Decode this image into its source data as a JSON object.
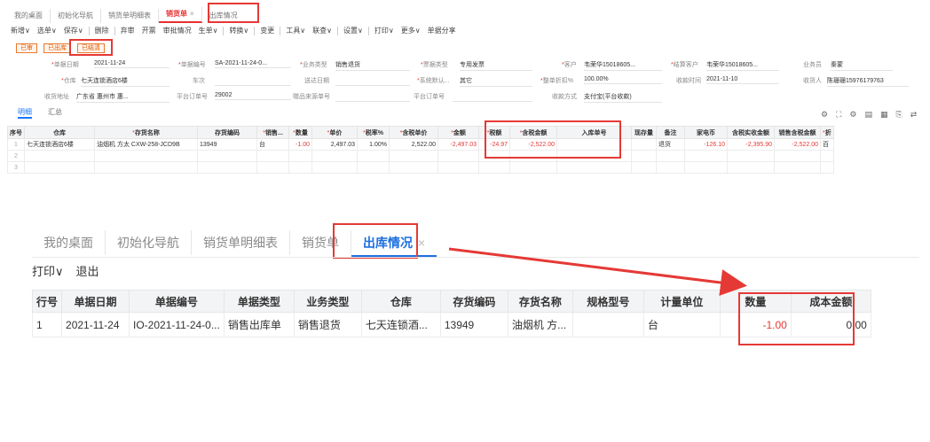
{
  "small_tabs": [
    {
      "label": "我的桌面"
    },
    {
      "label": "初始化导航"
    },
    {
      "label": "销货单明细表"
    },
    {
      "label": "销货单",
      "close": "×"
    },
    {
      "label": "出库情况"
    }
  ],
  "small_toolbar": [
    {
      "label": "新增∨"
    },
    {
      "label": "选单∨"
    },
    {
      "label": "保存∨"
    },
    {
      "label": "删除"
    },
    {
      "label": "弃审"
    },
    {
      "label": "开票"
    },
    {
      "label": "审批情况"
    },
    {
      "label": "生单∨"
    },
    {
      "label": "转换∨"
    },
    {
      "label": "变更"
    },
    {
      "label": "工具∨"
    },
    {
      "label": "联查∨"
    },
    {
      "label": "设置∨"
    },
    {
      "label": "打印∨"
    },
    {
      "label": "更多∨"
    },
    {
      "label": "单据分享"
    }
  ],
  "status_badges": [
    "已审",
    "已出库",
    "已结清"
  ],
  "form": {
    "doc_date_label": "单据日期",
    "doc_date": "2021-11-24",
    "doc_no_label": "单据编号",
    "doc_no": "SA-2021-11-24-0...",
    "biz_type_label": "业务类型",
    "biz_type": "销售退货",
    "invoice_type_label": "票据类型",
    "invoice_type": "专用发票",
    "customer_label": "客户",
    "customer": "韦荣华15018605...",
    "settle_customer_label": "结算客户",
    "settle_customer": "韦荣华15018605...",
    "salesman_label": "业务员",
    "salesman": "秦蒙",
    "warehouse_label": "仓库",
    "warehouse": "七天连锁酒店6楼",
    "trip_label": "车次",
    "trip": "",
    "delivery_date_label": "送达日期",
    "delivery_date": "",
    "default_label": "系统默认...",
    "default_value": "其它",
    "discount_label": "整单折扣%",
    "discount": "100.00%",
    "receive_time_label": "收款时间",
    "receive_time": "2021-11-10",
    "receiver_label": "收货人",
    "receiver": "陈珊珊15976179763",
    "address_label": "收货地址",
    "address": "广东省 惠州市 惠...",
    "platform_order_label": "平台订单号",
    "platform_order": "29002",
    "source_label": "赠品来源单号",
    "source": "",
    "platform_order2_label": "平台订单号",
    "platform_order2": "",
    "pay_method_label": "收款方式",
    "pay_method": "支付宝(平台收款)"
  },
  "detail_tabs": [
    "明细",
    "汇总"
  ],
  "right_icons": [
    "⚙",
    "⛶",
    "⚙",
    "▤",
    "▦",
    "⎘",
    "⇄"
  ],
  "small_grid": {
    "headers": [
      "序号",
      "仓库",
      "存货名称",
      "存货编码",
      "销售...",
      "数量",
      "单价",
      "税率%",
      "含税单价",
      "金额",
      "税额",
      "含税金额",
      "入库单号",
      "现存量",
      "备注",
      "家电币",
      "含税实收金额",
      "销售含税金额",
      "折"
    ],
    "rows": [
      [
        "1",
        "七天连锁酒店6楼",
        "油烟机 方太 CXW-258-JCD9B",
        "13949",
        "台",
        "-1.00",
        "2,497.03",
        "1.00%",
        "2,522.00",
        "-2,497.03",
        "-24.97",
        "-2,522.00",
        "",
        "",
        "退货",
        "-126.10",
        "-2,395.90",
        "-2,522.00",
        "百"
      ],
      [
        "2",
        "",
        "",
        "",
        "",
        "",
        "",
        "",
        "",
        "",
        "",
        "",
        "",
        "",
        "",
        "",
        "",
        "",
        ""
      ],
      [
        "3",
        "",
        "",
        "",
        "",
        "",
        "",
        "",
        "",
        "",
        "",
        "",
        "",
        "",
        "",
        "",
        "",
        "",
        ""
      ]
    ]
  },
  "large_tabs": [
    {
      "label": "我的桌面"
    },
    {
      "label": "初始化导航"
    },
    {
      "label": "销货单明细表"
    },
    {
      "label": "销货单"
    },
    {
      "label": "出库情况",
      "close": "×"
    }
  ],
  "large_toolbar": [
    "打印∨",
    "退出"
  ],
  "large_grid": {
    "headers": [
      "行号",
      "单据日期",
      "单据编号",
      "单据类型",
      "业务类型",
      "仓库",
      "存货编码",
      "存货名称",
      "规格型号",
      "计量单位",
      "数量",
      "成本金额"
    ],
    "rows": [
      [
        "1",
        "2021-11-24",
        "IO-2021-11-24-0...",
        "销售出库单",
        "销售退货",
        "七天连锁酒...",
        "13949",
        "油烟机 方...",
        "",
        "台",
        "-1.00",
        "0.00"
      ]
    ]
  },
  "colors": {
    "highlight": "#e53935",
    "accent": "#1d6fe0",
    "negative": "#e53935"
  }
}
